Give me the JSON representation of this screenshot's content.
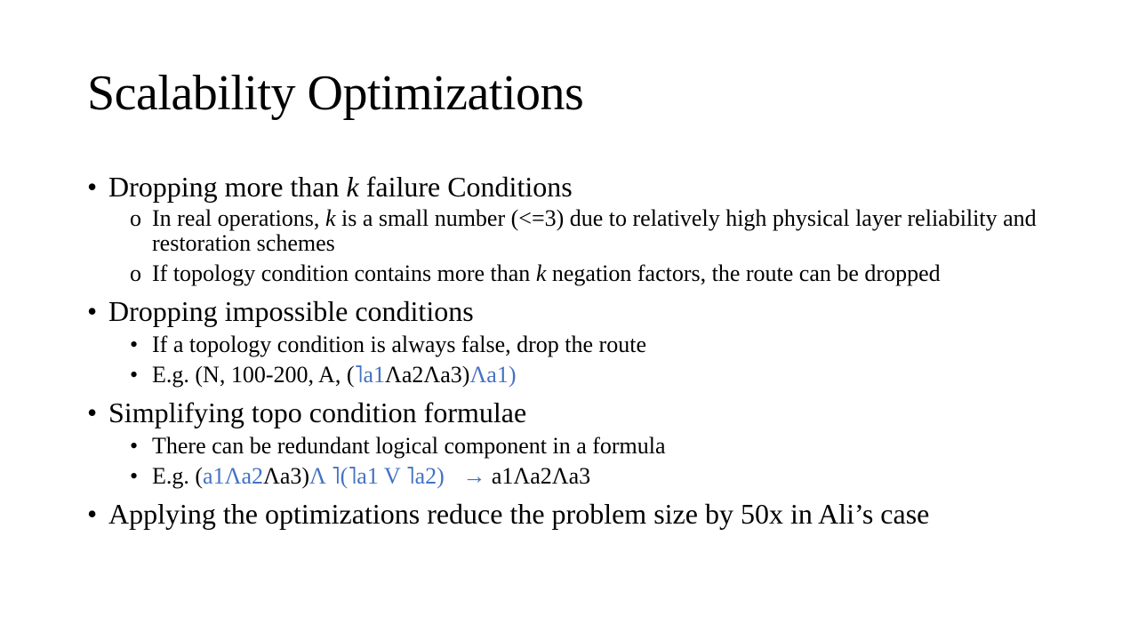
{
  "slide": {
    "title": "Scalability Optimizations",
    "bullets": [
      {
        "text_pre": "Dropping more than ",
        "text_k": "k",
        "text_post": " failure Conditions",
        "sub_marker": "o",
        "subs": [
          {
            "pre": "In real operations, ",
            "k": "k",
            "post": " is a small number (<=3) due to relatively high physical layer reliability and restoration schemes"
          },
          {
            "pre": "If topology condition contains more than ",
            "k": "k",
            "post": " negation factors, the route can be dropped"
          }
        ]
      },
      {
        "text": "Dropping impossible conditions",
        "sub_marker": "•",
        "sub1": "If a topology condition is always false, drop the route",
        "sub2_prefix": "E.g. (N, 100-200, A, (",
        "sub2_blue1": "˥a1",
        "sub2_mid": "Λa2Λa3)",
        "sub2_blue2": "Λa1)"
      },
      {
        "text": "Simplifying topo condition formulae",
        "sub_marker": "•",
        "sub1": "There can be redundant logical component in a formula",
        "sub2_prefix": "E.g. (",
        "sub2_blue1": "a1Λa2",
        "sub2_mid": "Λa3)",
        "sub2_blue2": "Λ ˥(˥a1 V ˥a2)",
        "sub2_arrow": "→",
        "sub2_result": "a1Λa2Λa3"
      },
      {
        "text": "Applying the optimizations reduce the problem size by 50x in Ali’s case"
      }
    ],
    "bullet_marker": "•",
    "colors": {
      "text": "#000000",
      "accent": "#4472c4",
      "background": "#ffffff"
    }
  }
}
